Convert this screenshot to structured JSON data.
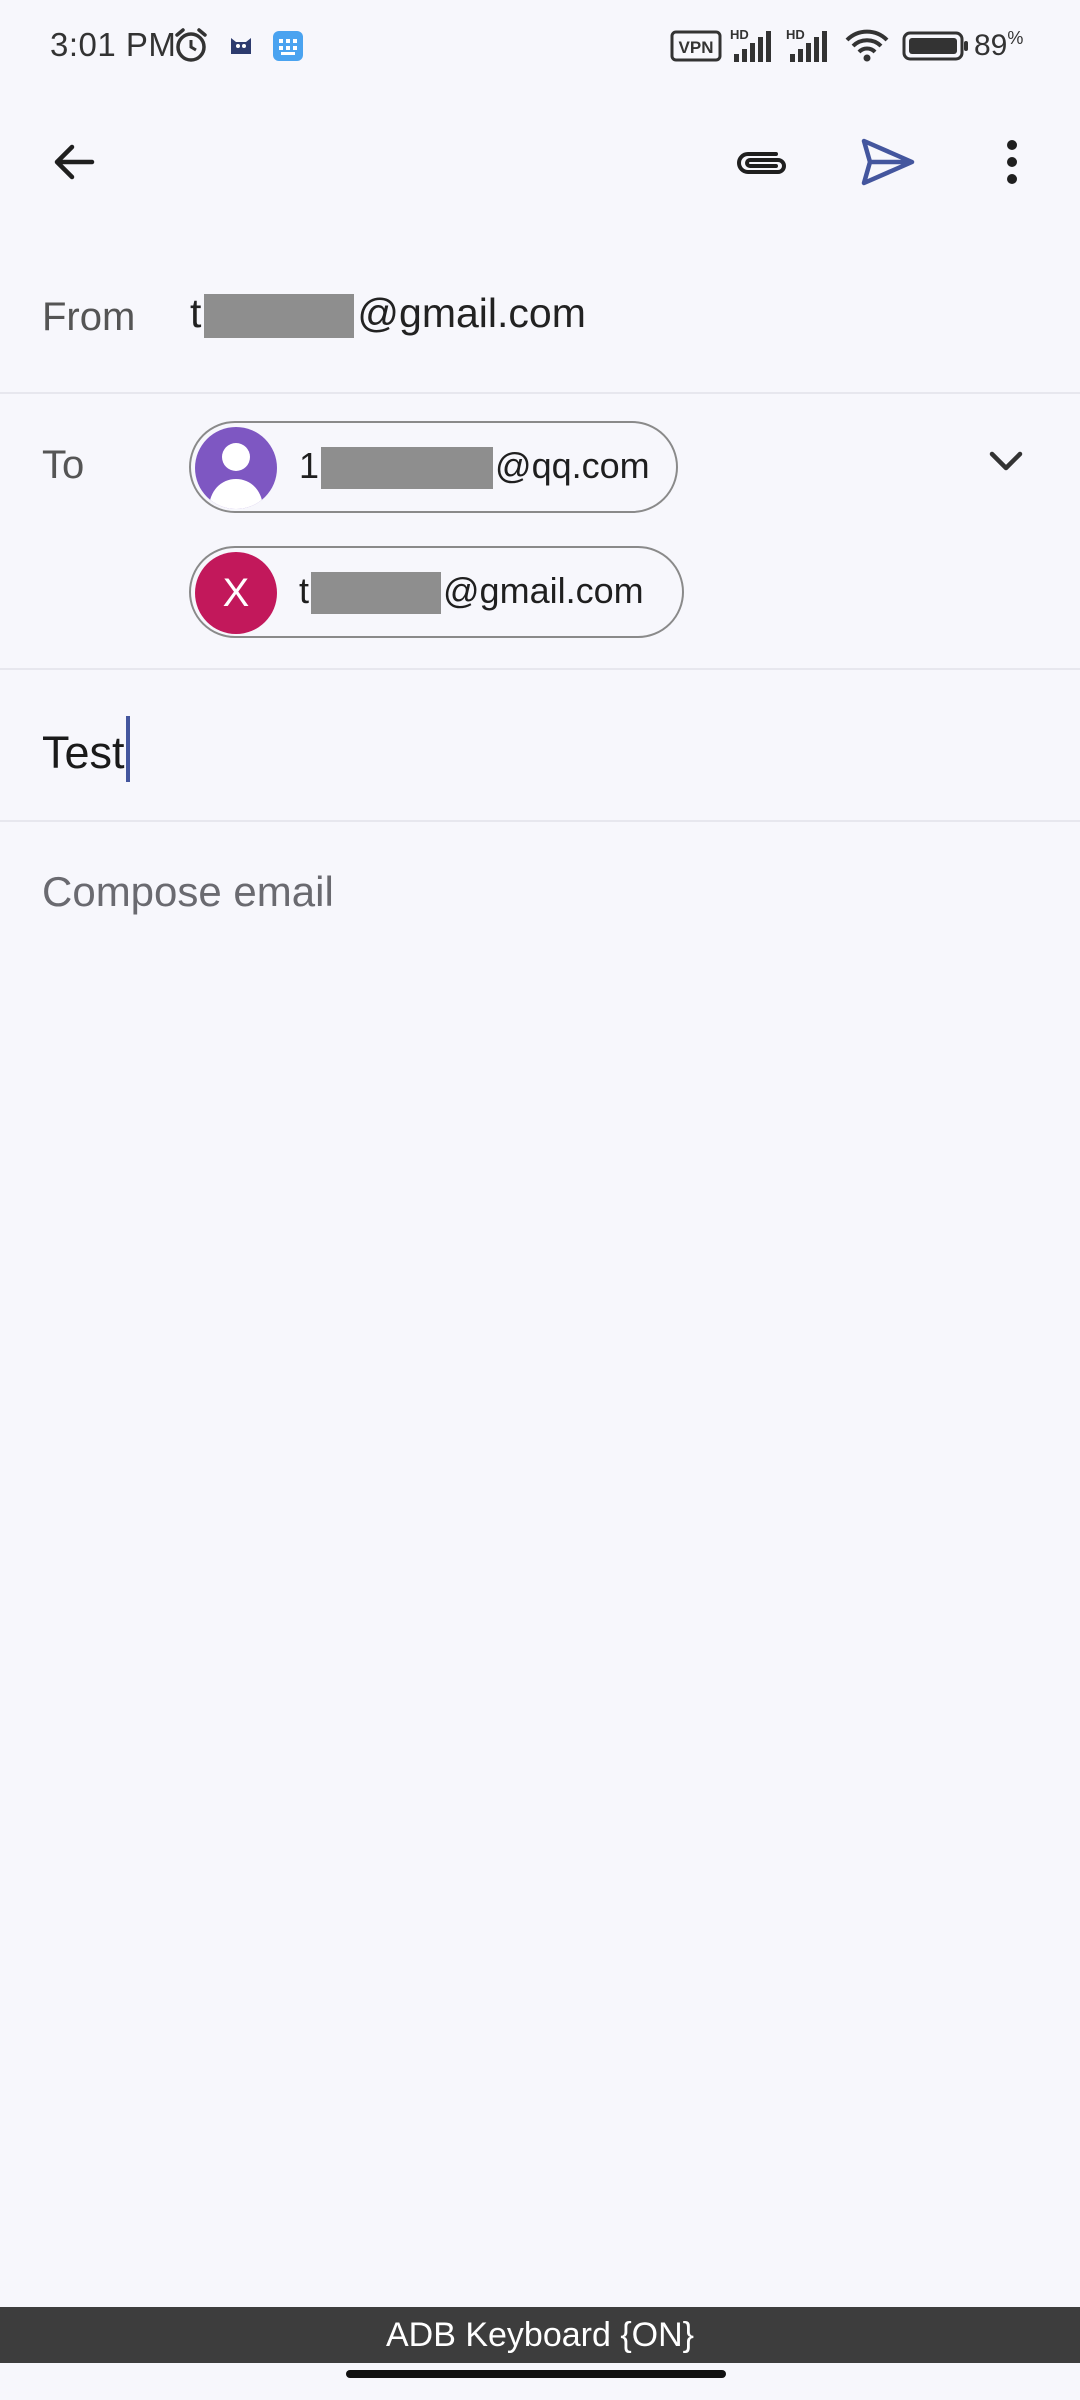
{
  "status_bar": {
    "time": "3:01 PM",
    "battery": "89",
    "battery_unit": "%",
    "vpn_label": "VPN",
    "icons": [
      "alarm-icon",
      "cat-app-icon",
      "keyboard-app-icon",
      "vpn-icon",
      "hd-signal-icon",
      "hd-signal-icon",
      "wifi-icon",
      "battery-icon"
    ]
  },
  "toolbar": {
    "back_icon": "arrow-back-icon",
    "attach_icon": "paperclip-icon",
    "send_icon": "send-icon",
    "more_icon": "more-vert-icon"
  },
  "compose": {
    "from_label": "From",
    "from_prefix": "t",
    "from_suffix": "@gmail.com",
    "to_label": "To",
    "recipients": [
      {
        "prefix": "1",
        "suffix": "@qq.com",
        "avatar": "person-avatar-icon"
      },
      {
        "prefix": "t",
        "suffix": "@gmail.com",
        "avatar_letter": "X"
      }
    ],
    "subject": "Test",
    "body_placeholder": "Compose email"
  },
  "keyboard_bar": "ADB Keyboard {ON}",
  "colors": {
    "background": "#f7f7fc",
    "accent": "#44569e",
    "avatar_purple": "#7e57c2",
    "avatar_magenta": "#c2185b"
  }
}
